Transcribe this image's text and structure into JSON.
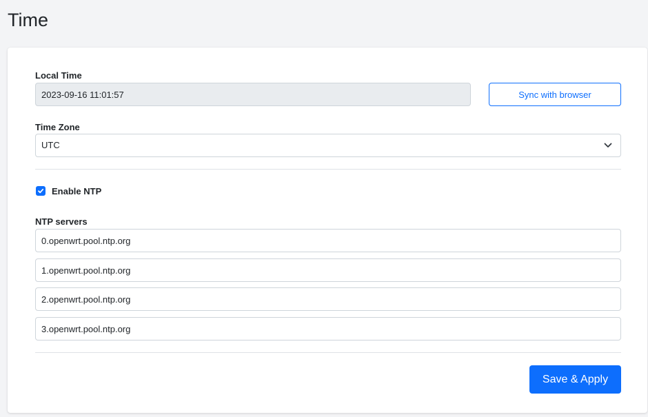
{
  "page": {
    "title": "Time"
  },
  "local_time": {
    "label": "Local Time",
    "value": "2023-09-16 11:01:57",
    "sync_button_label": "Sync with browser"
  },
  "time_zone": {
    "label": "Time Zone",
    "selected": "UTC",
    "icon": "chevron-down-icon"
  },
  "ntp": {
    "enable_label": "Enable NTP",
    "enabled": true,
    "servers_label": "NTP servers",
    "servers": [
      "0.openwrt.pool.ntp.org",
      "1.openwrt.pool.ntp.org",
      "2.openwrt.pool.ntp.org",
      "3.openwrt.pool.ntp.org"
    ]
  },
  "actions": {
    "save_apply_label": "Save & Apply"
  },
  "colors": {
    "accent": "#0d6efd",
    "page_background": "#f3f4f6",
    "readonly_background": "#e9ecef",
    "border": "#ced4da"
  }
}
